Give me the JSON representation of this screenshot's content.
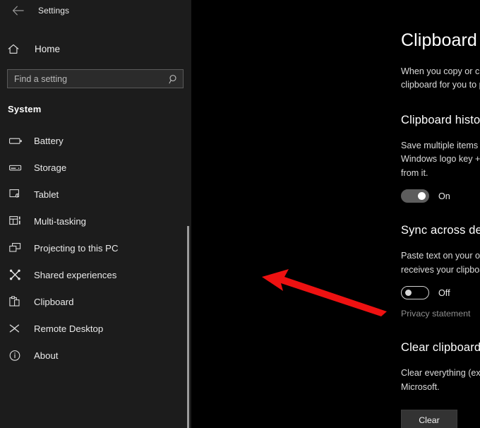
{
  "window": {
    "title": "Settings",
    "back_icon": "back-arrow-icon"
  },
  "sidebar": {
    "home_label": "Home",
    "home_icon": "home-icon",
    "search": {
      "placeholder": "Find a setting",
      "value": "",
      "icon": "search-icon"
    },
    "group_title": "System",
    "items": [
      {
        "label": "Battery",
        "icon": "battery-icon"
      },
      {
        "label": "Storage",
        "icon": "storage-drive-icon"
      },
      {
        "label": "Tablet",
        "icon": "tablet-icon"
      },
      {
        "label": "Multi-tasking",
        "icon": "multitasking-icon"
      },
      {
        "label": "Projecting to this PC",
        "icon": "projecting-icon"
      },
      {
        "label": "Shared experiences",
        "icon": "shared-experiences-icon"
      },
      {
        "label": "Clipboard",
        "icon": "clipboard-icon"
      },
      {
        "label": "Remote Desktop",
        "icon": "remote-desktop-icon"
      },
      {
        "label": "About",
        "icon": "info-icon"
      }
    ]
  },
  "main": {
    "page_title": "Clipboard",
    "page_desc": "When you copy or cut something in Windows, it is copied to the clipboard for you to paste.",
    "sections": [
      {
        "heading": "Clipboard history",
        "desc": "Save multiple items to the clipboard to use later. Press the Windows logo key + V to view your clipboard history and paste from it.",
        "toggle_state": "On"
      },
      {
        "heading": "Sync across devices",
        "desc": "Paste text on your other devices. When this is on, Microsoft receives your clipboard data to sync it across your devices.",
        "toggle_state": "Off",
        "link_label": "Privacy statement"
      },
      {
        "heading": "Clear clipboard data",
        "desc": "Clear everything (except pinned items) on this device and with Microsoft.",
        "button_label": "Clear"
      }
    ]
  },
  "annotation": {
    "arrow_color": "#ee1111",
    "arrow_name": "red-pointer-arrow"
  },
  "colors": {
    "sidebar_bg": "#1c1c1c",
    "content_bg": "#000000",
    "accent_text": "#ffffff",
    "muted_text": "#dcdcdc",
    "link_text": "#8e8e8e",
    "toggle_on_fill": "#5d5d5d",
    "button_fill": "#333333"
  }
}
